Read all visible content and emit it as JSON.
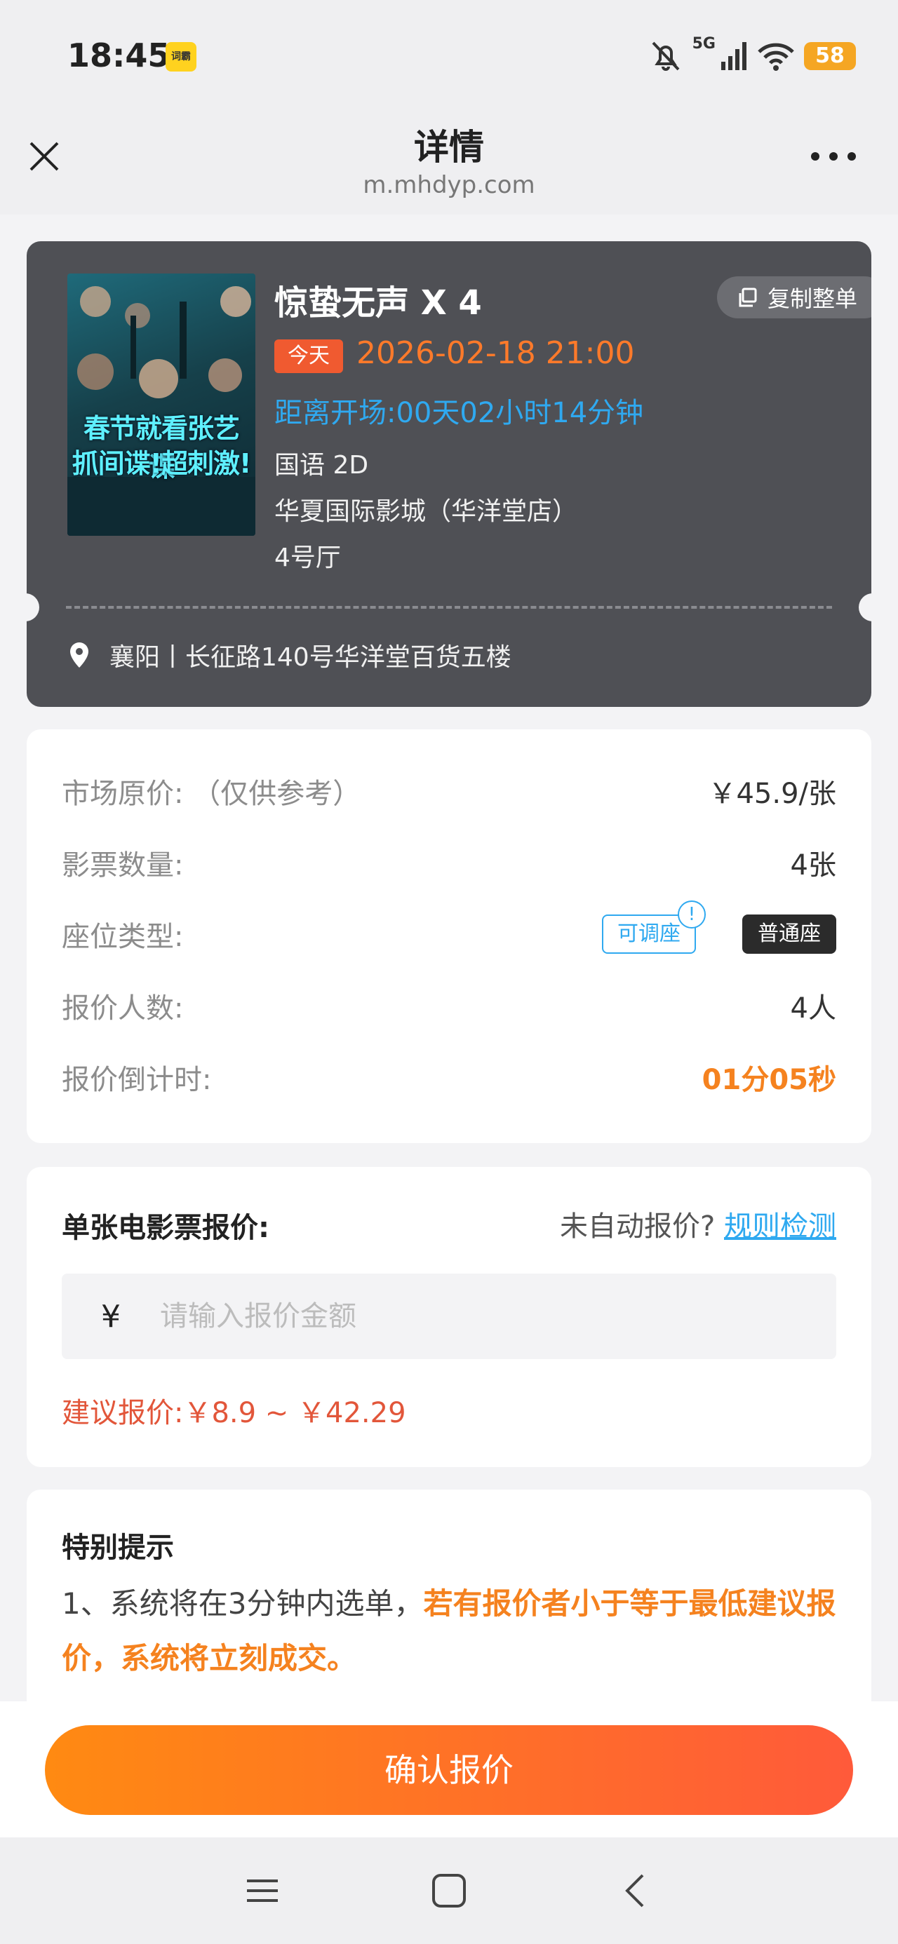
{
  "status": {
    "time": "18:45",
    "app_badge": "词霸",
    "network": "5G",
    "battery": "58"
  },
  "nav": {
    "title": "详情",
    "subtitle": "m.mhdyp.com"
  },
  "movie": {
    "poster_text_1": "春节就看张艺谋",
    "poster_text_2": "抓间谍!超刺激!",
    "title": "惊蛰无声  X 4",
    "copy_label": "复制整单",
    "today_label": "今天",
    "show_time": "2026-02-18 21:00",
    "countdown": "距离开场:00天02小时14分钟",
    "language": "国语 2D",
    "cinema": "华夏国际影城（华洋堂店）",
    "hall": "4号厅",
    "address": "襄阳丨长征路140号华洋堂百货五楼"
  },
  "info": {
    "market_price_label": "市场原价:  （仅供参考）",
    "market_price_value": "￥45.9/张",
    "ticket_count_label": "影票数量:",
    "ticket_count_value": "4张",
    "seat_type_label": "座位类型:",
    "seat_adjustable": "可调座",
    "seat_adjustable_mark": "!",
    "seat_normal": "普通座",
    "bidders_label": "报价人数:",
    "bidders_value": "4人",
    "countdown_label": "报价倒计时:",
    "countdown_value": "01分05秒"
  },
  "quote": {
    "label": "单张电影票报价:",
    "auto_question": "未自动报价?",
    "rule_link": "规则检测",
    "currency": "¥",
    "placeholder": "请输入报价金额",
    "suggest": "建议报价:￥8.9 ~ ￥42.29"
  },
  "notice": {
    "title": "特别提示",
    "text_plain": "1、系统将在3分钟内选单，",
    "text_highlight": "若有报价者小于等于最低建议报价，系统将立刻成交。"
  },
  "confirm_label": "确认报价"
}
